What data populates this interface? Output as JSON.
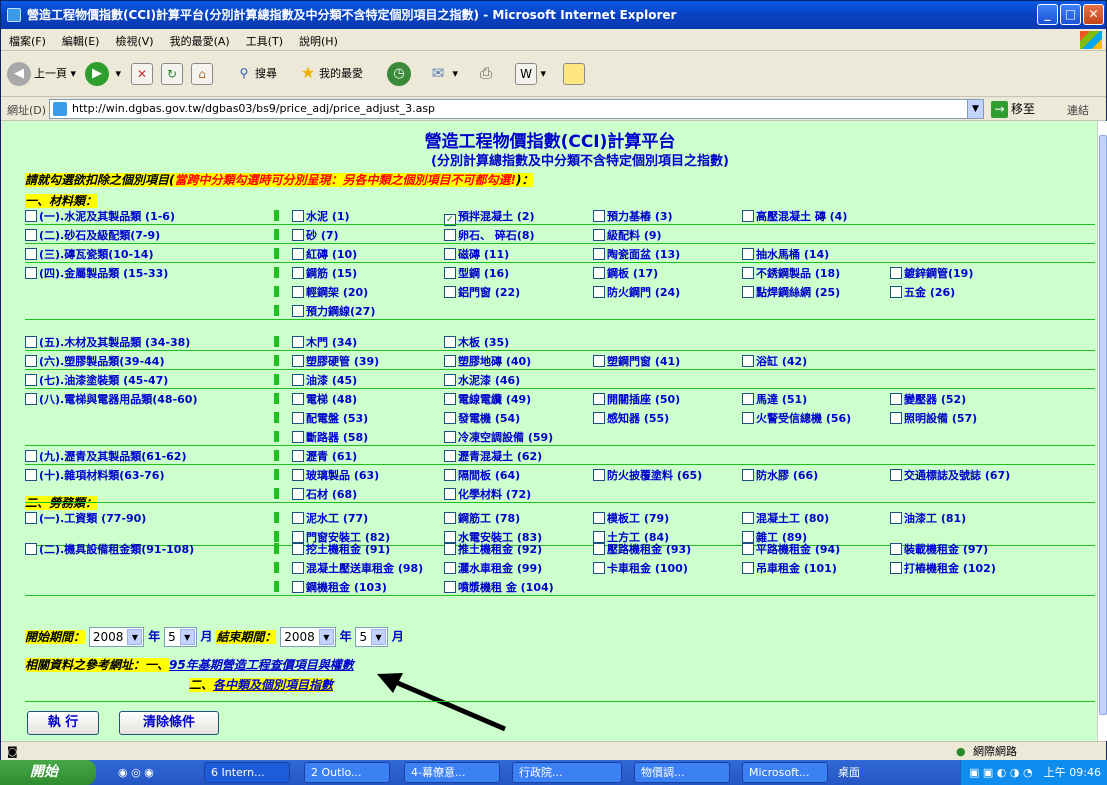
{
  "window": {
    "title": "營造工程物價指數(CCI)計算平台(分別計算總指數及中分類不含特定個別項目之指數) - Microsoft Internet Explorer"
  },
  "menus": [
    "檔案(F)",
    "編輯(E)",
    "檢視(V)",
    "我的最愛(A)",
    "工具(T)",
    "說明(H)"
  ],
  "toolbar": {
    "back": "上一頁",
    "search": "搜尋",
    "favorites": "我的最愛"
  },
  "address": {
    "label": "網址(D)",
    "url": "http://win.dgbas.gov.tw/dgbas03/bs9/price_adj/price_adjust_3.asp",
    "go": "移至",
    "links": "連結"
  },
  "page": {
    "title": "營造工程物價指數(CCI)計算平台",
    "subtitle": "(分別計算總指數及中分類不含特定個別項目之指數)",
    "instruction_a": "請就勾選欲扣除之個別項目(",
    "instruction_b": "當跨中分類勾選時可分別呈現：另各中類之個別項目不可都勾選!",
    "instruction_c": ")：",
    "section1": "一、材料類：",
    "section2": "二、勞務類："
  },
  "material_groups": [
    {
      "label": "(一).水泥及其製品類 (1-6)",
      "items": [
        "水泥 (1)",
        "預拌混凝土 (2)",
        "預力基樁 (3)",
        "高壓混凝土 磚 (4)"
      ]
    },
    {
      "label": "(二).砂石及級配類(7-9)",
      "items": [
        "砂 (7)",
        "卵石、 碎石(8)",
        "級配料 (9)"
      ]
    },
    {
      "label": "(三).磚瓦瓷類(10-14)",
      "items": [
        "紅磚 (10)",
        "磁磚 (11)",
        "陶瓷面盆 (13)",
        "抽水馬桶 (14)"
      ]
    },
    {
      "label": "(四).金屬製品類 (15-33)",
      "items": [
        "鋼筋 (15)",
        "型鋼 (16)",
        "鋼板 (17)",
        "不銹鋼製品 (18)",
        "鍍鋅鋼管(19)",
        "輕鋼架 (20)",
        "鋁門窗 (22)",
        "防火鋼門 (24)",
        "點焊鋼絲網 (25)",
        "五金 (26)",
        "預力鋼線(27)"
      ]
    },
    {
      "label": "(五).木材及其製品類 (34-38)",
      "items": [
        "木門 (34)",
        "木板 (35)"
      ]
    },
    {
      "label": "(六).塑膠製品類(39-44)",
      "items": [
        "塑膠硬管 (39)",
        "塑膠地磚 (40)",
        "塑鋼門窗 (41)",
        "浴缸 (42)"
      ]
    },
    {
      "label": "(七).油漆塗裝類 (45-47)",
      "items": [
        "油漆 (45)",
        "水泥漆 (46)"
      ]
    },
    {
      "label": "(八).電梯與電器用品類(48-60)",
      "items": [
        "電梯 (48)",
        "電線電纜 (49)",
        "開關插座 (50)",
        "馬達 (51)",
        "變壓器 (52)",
        "配電盤 (53)",
        "發電機 (54)",
        "感知器 (55)",
        "火警受信總機 (56)",
        "照明設備 (57)",
        "斷路器 (58)",
        "冷凍空調設備 (59)"
      ]
    },
    {
      "label": "(九).瀝青及其製品類(61-62)",
      "items": [
        "瀝青 (61)",
        "瀝青混凝土 (62)"
      ]
    },
    {
      "label": "(十).雜項材料類(63-76)",
      "items": [
        "玻璃製品 (63)",
        "隔間板 (64)",
        "防火披覆塗料 (65)",
        "防水膠 (66)",
        "交通標誌及號誌 (67)",
        "石材 (68)",
        "化學材料 (72)"
      ]
    }
  ],
  "labor_groups": [
    {
      "label": "(一).工資類 (77-90)",
      "items": [
        "泥水工 (77)",
        "鋼筋工 (78)",
        "模板工 (79)",
        "混凝土工 (80)",
        "油漆工 (81)",
        "門窗安裝工 (82)",
        "水電安裝工 (83)",
        "土方工 (84)",
        "雜工 (89)"
      ]
    },
    {
      "label": "(二).機具設備租金類(91-108)",
      "items": [
        "挖土機租金 (91)",
        "推土機租金 (92)",
        "壓路機租金 (93)",
        "平路機租金 (94)",
        "裝載機租金 (97)",
        "混凝土壓送車租金 (98)",
        "灑水車租金 (99)",
        "卡車租金 (100)",
        "吊車租金 (101)",
        "打樁機租金 (102)",
        "鋼機租金 (103)",
        "噴漿機租 金 (104)"
      ]
    }
  ],
  "checked_items": [
    "預拌混凝土 (2)"
  ],
  "period": {
    "start_label": "開始期間：",
    "start_year": "2008",
    "year_unit": "年",
    "start_month": "5",
    "month_unit": "月",
    "end_label": "結束期間：",
    "end_year": "2008",
    "end_month": "5"
  },
  "reference": {
    "label": "相關資料之參考網址：",
    "item1_prefix": "一、",
    "item1_link": "95年基期營造工程查價項目與權數",
    "item2_prefix": "二、",
    "item2_link": "各中類及個別項目指數"
  },
  "buttons": {
    "run": "執 行",
    "clear": "清除條件"
  },
  "status": {
    "zone": "網際網路"
  },
  "taskbar": {
    "start": "開始",
    "tasks": [
      "6 Intern...",
      "2 Outlo...",
      "4-幕僚意...",
      "行政院...",
      "物價調...",
      "Microsoft..."
    ],
    "desktop": "桌面",
    "clock": "上午 09:46"
  },
  "colors": {
    "page_bg": "#ccffcc",
    "link_blue": "#0000cc",
    "highlight": "#ffff00",
    "accent_green": "#21c021"
  }
}
